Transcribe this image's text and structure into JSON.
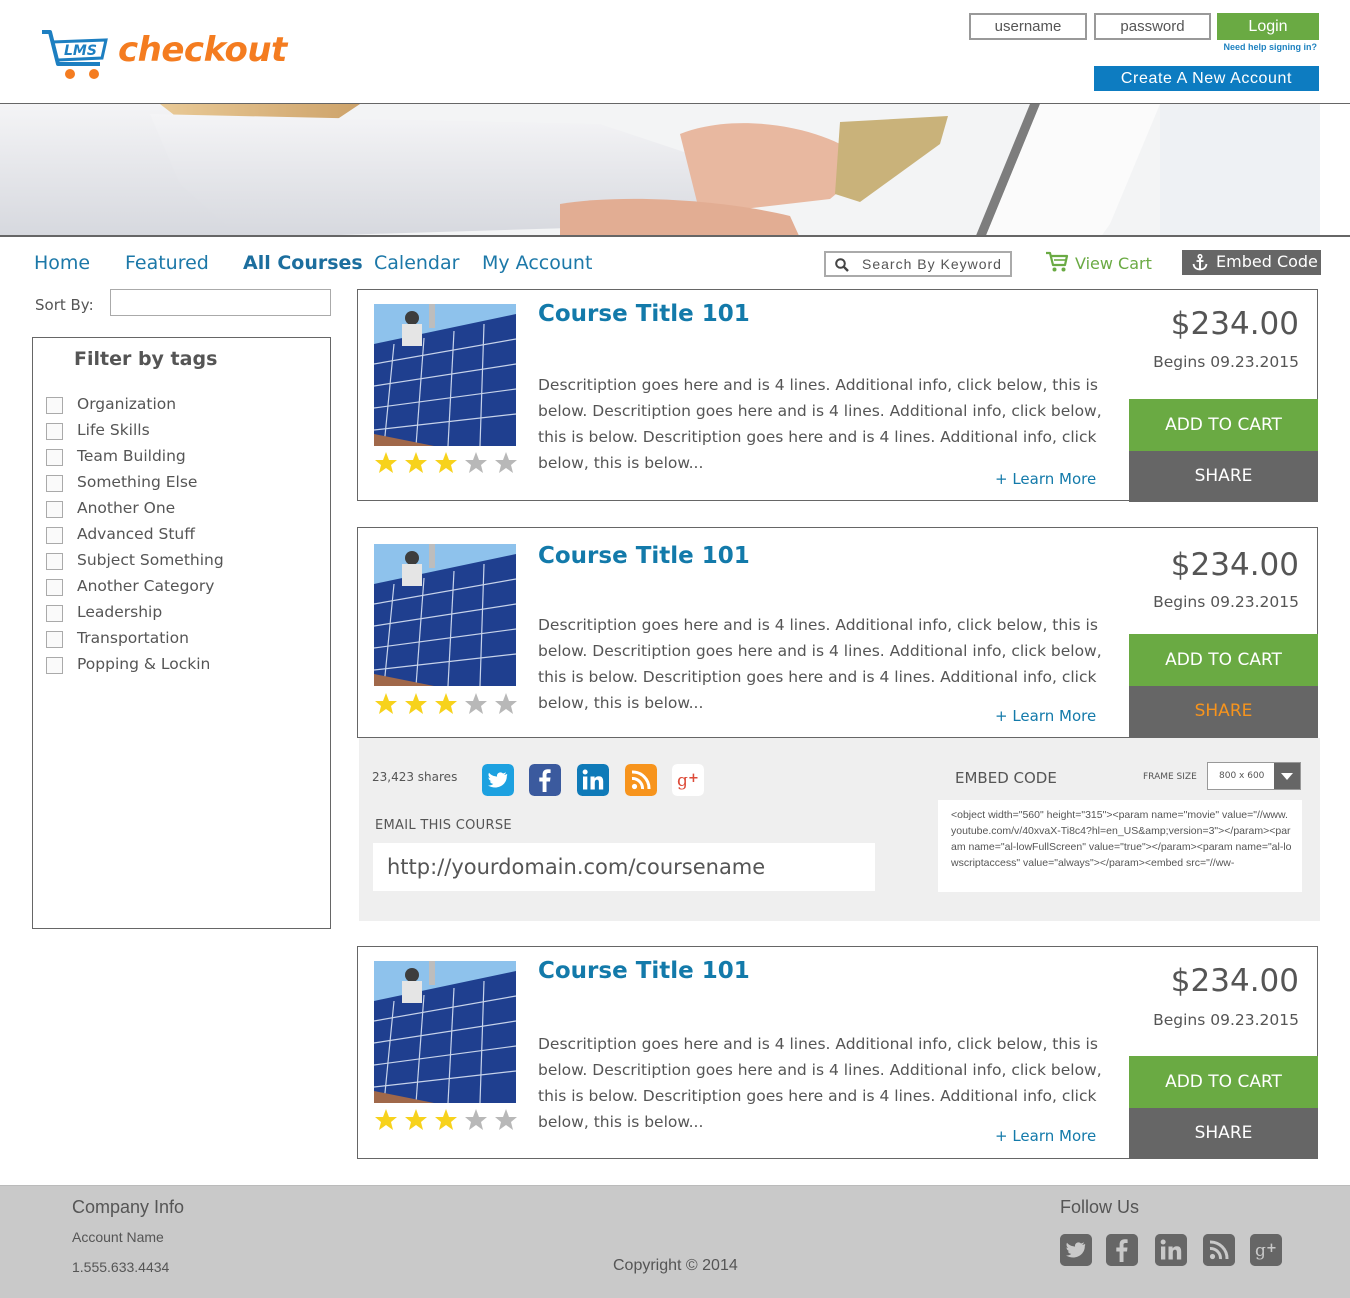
{
  "header": {
    "logo_text": "checkout",
    "logo_mark": "LMS",
    "username_placeholder": "username",
    "password_placeholder": "password",
    "login_label": "Login",
    "help_link": "Need help signing in?",
    "create_account_label": "Create  A  New  Account"
  },
  "nav": {
    "items": [
      "Home",
      "Featured",
      "All Courses",
      "Calendar",
      "My Account"
    ],
    "active": "All Courses",
    "search_placeholder": "Search By Keyword",
    "view_cart_label": "View Cart",
    "embed_code_label": "Embed Code"
  },
  "sidebar": {
    "sort_by_label": "Sort By:",
    "filter_title": "Filter by tags",
    "tags": [
      "Organization",
      "Life Skills",
      "Team Building",
      "Something Else",
      "Another One",
      "Advanced Stuff",
      "Subject Something",
      "Another Category",
      "Leadership",
      "Transportation",
      "Popping & Lockin"
    ]
  },
  "courses": [
    {
      "title": "Course Title 101",
      "description": "Descritiption goes here and is 4 lines.  Additional info, click below, this is below. Descritiption goes here and is 4 lines.  Additional info, click below, this is below.  Descritiption goes here and is 4 lines.  Additional info, click below, this is below...",
      "learn_more": "+ Learn More",
      "price": "$234.00",
      "begins": "Begins 09.23.2015",
      "add_to_cart": "ADD TO CART",
      "share": "SHARE",
      "rating": 3,
      "rating_max": 5
    },
    {
      "title": "Course Title 101",
      "description": "Descritiption goes here and is 4 lines.  Additional info, click below, this is below. Descritiption goes here and is 4 lines.  Additional info, click below, this is below.  Descritiption goes here and is 4 lines.  Additional info, click below, this is below...",
      "learn_more": "+ Learn More",
      "price": "$234.00",
      "begins": "Begins 09.23.2015",
      "add_to_cart": "ADD TO CART",
      "share": "SHARE",
      "rating": 3,
      "rating_max": 5
    },
    {
      "title": "Course Title 101",
      "description": "Descritiption goes here and is 4 lines.  Additional info, click below, this is below. Descritiption goes here and is 4 lines.  Additional info, click below, this is below.  Descritiption goes here and is 4 lines.  Additional info, click below, this is below...",
      "learn_more": "+ Learn More",
      "price": "$234.00",
      "begins": "Begins 09.23.2015",
      "add_to_cart": "ADD TO CART",
      "share": "SHARE",
      "rating": 3,
      "rating_max": 5
    }
  ],
  "share_panel": {
    "shares_count": "23,423 shares",
    "social_icons": [
      "twitter-icon",
      "facebook-icon",
      "linkedin-icon",
      "rss-icon",
      "google-plus-icon"
    ],
    "email_label": "EMAIL THIS COURSE",
    "email_value": "http://yourdomain.com/coursename",
    "embed_label": "EMBED CODE",
    "frame_size_label": "FRAME SIZE",
    "frame_size_value": "800 x 600",
    "embed_code": "<object width=\"560\" height=\"315\"><param name=\"movie\" value=\"//www.youtube.com/v/40xvaX-Ti8c4?hl=en_US&amp;version=3\"></param><param name=\"al-lowFullScreen\" value=\"true\"></param><param name=\"al-lowscriptaccess\" value=\"always\"></param><embed src=\"//ww-"
  },
  "footer": {
    "company_info": "Company Info",
    "account_name": "Account Name",
    "phone": "1.555.633.4434",
    "copyright": "Copyright © 2014",
    "follow_us": "Follow Us",
    "social_icons": [
      "twitter-icon",
      "facebook-icon",
      "linkedin-icon",
      "rss-icon",
      "google-plus-icon"
    ]
  },
  "colors": {
    "brand_orange": "#f47c20",
    "brand_blue": "#0d7cc1",
    "green": "#6aaa43",
    "link_blue": "#137aaa",
    "share_active": "#f7941d",
    "gray_dark": "#666666"
  }
}
